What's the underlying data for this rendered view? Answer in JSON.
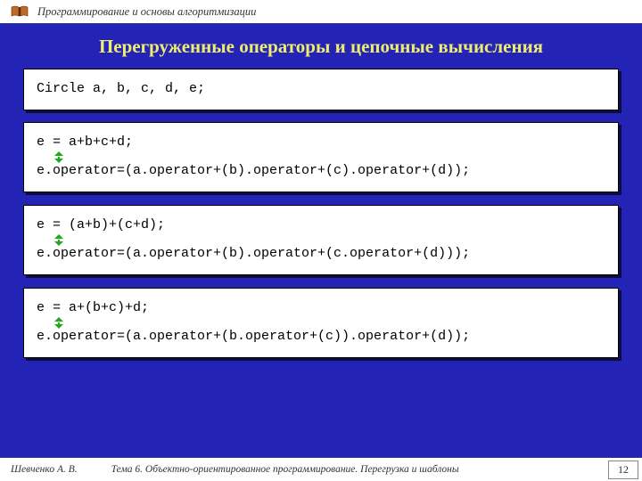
{
  "header": {
    "course_title": "Программирование и основы алгоритмизации"
  },
  "slide": {
    "title": "Перегруженные операторы и цепочные вычисления",
    "blocks": [
      {
        "lines": [
          "Circle a, b, c, d, e;"
        ],
        "arrow_after_first": false
      },
      {
        "lines": [
          "e = a+b+c+d;",
          "e.operator=(a.operator+(b).operator+(c).operator+(d));"
        ],
        "arrow_after_first": true
      },
      {
        "lines": [
          "e = (a+b)+(c+d);",
          "e.operator=(a.operator+(b).operator+(c.operator+(d)));"
        ],
        "arrow_after_first": true
      },
      {
        "lines": [
          "e = a+(b+c)+d;",
          "e.operator=(a.operator+(b.operator+(c)).operator+(d));"
        ],
        "arrow_after_first": true
      }
    ]
  },
  "footer": {
    "author": "Шевченко А. В.",
    "topic": "Тема 6. Объектно-ориентированное программирование. Перегрузка и шаблоны",
    "page": "12"
  }
}
